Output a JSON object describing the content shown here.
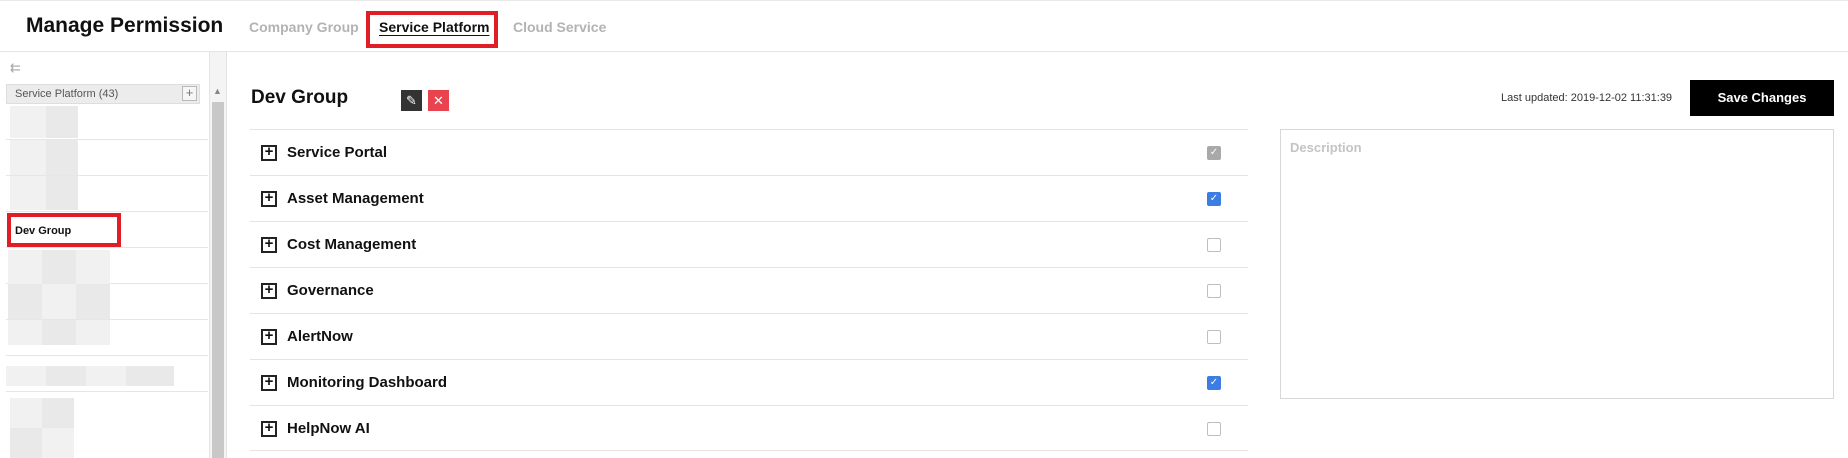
{
  "app": {
    "title": "Manage Permission"
  },
  "tabs": [
    {
      "label": "Company Group",
      "active": false
    },
    {
      "label": "Service Platform",
      "active": true
    },
    {
      "label": "Cloud Service",
      "active": false
    }
  ],
  "sidebar": {
    "header": "Service Platform (43)",
    "add_symbol": "+",
    "collapse_icon": "collapse-left-icon",
    "selected_item": "Dev Group"
  },
  "detail": {
    "group_name": "Dev Group",
    "edit_icon": "pencil-icon",
    "delete_icon": "close-icon",
    "last_updated": "Last updated: 2019-12-02 11:31:39",
    "save_label": "Save Changes",
    "description_placeholder": "Description"
  },
  "permissions": [
    {
      "label": "Service Portal",
      "checked": true,
      "disabled": true
    },
    {
      "label": "Asset Management",
      "checked": true,
      "disabled": false
    },
    {
      "label": "Cost Management",
      "checked": false,
      "disabled": false
    },
    {
      "label": "Governance",
      "checked": false,
      "disabled": false
    },
    {
      "label": "AlertNow",
      "checked": false,
      "disabled": false
    },
    {
      "label": "Monitoring Dashboard",
      "checked": true,
      "disabled": false
    },
    {
      "label": "HelpNow AI",
      "checked": false,
      "disabled": false
    }
  ],
  "colors": {
    "accent": "#3b7de3",
    "highlight": "#e01e26",
    "delete": "#e8434f"
  }
}
